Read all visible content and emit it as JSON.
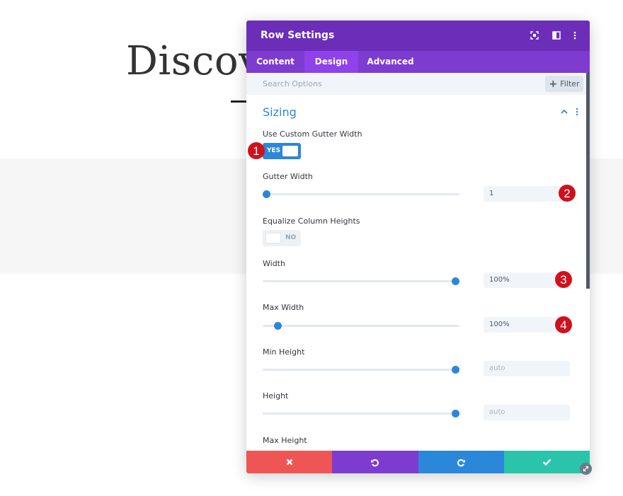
{
  "background": {
    "heading": "Discove"
  },
  "modal": {
    "title": "Row Settings",
    "tabs": [
      {
        "label": "Content"
      },
      {
        "label": "Design"
      },
      {
        "label": "Advanced"
      }
    ],
    "active_tab": "Design",
    "search": {
      "placeholder": "Search Options"
    },
    "filter_label": "Filter",
    "section": {
      "title": "Sizing"
    },
    "options": {
      "custom_gutter": {
        "label": "Use Custom Gutter Width",
        "toggle_text": "YES"
      },
      "gutter_width": {
        "label": "Gutter Width",
        "value": "1",
        "slider_fraction": 0.0
      },
      "equalize_heights": {
        "label": "Equalize Column Heights",
        "toggle_text": "NO"
      },
      "width": {
        "label": "Width",
        "value": "100%",
        "slider_fraction": 1.0
      },
      "max_width": {
        "label": "Max Width",
        "value": "100%",
        "slider_fraction": 0.06
      },
      "min_height": {
        "label": "Min Height",
        "value": "auto",
        "slider_fraction": 1.0
      },
      "height": {
        "label": "Height",
        "value": "auto",
        "slider_fraction": 1.0
      },
      "max_height": {
        "label": "Max Height"
      }
    }
  },
  "badges": [
    "1",
    "2",
    "3",
    "4"
  ],
  "colors": {
    "header": "#6c2eb9",
    "tabs": "#7e3bd0",
    "accent": "#2b87da",
    "cancel": "#ef5555",
    "undo": "#7e3bd0",
    "redo": "#2b87da",
    "save": "#29c4a9",
    "badge": "#d0111c"
  },
  "footer_icons": [
    "close-icon",
    "undo-icon",
    "redo-icon",
    "check-icon"
  ]
}
